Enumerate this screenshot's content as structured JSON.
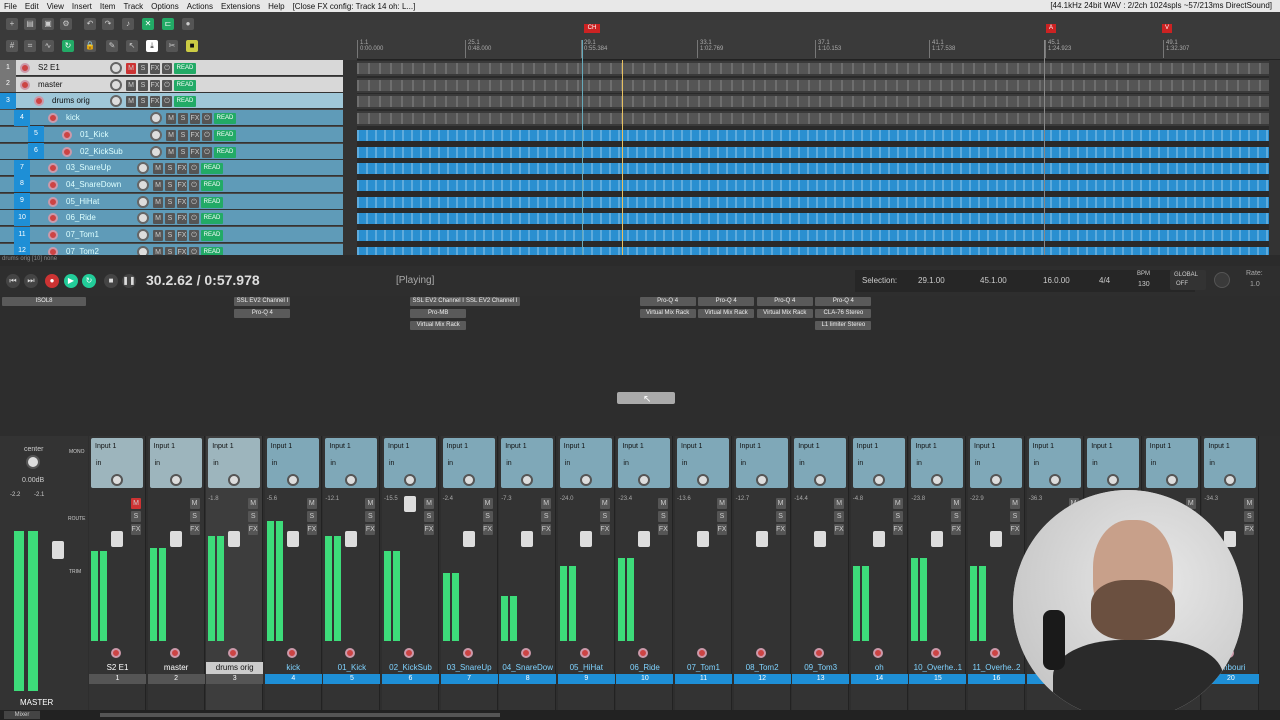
{
  "menu": [
    "File",
    "Edit",
    "View",
    "Insert",
    "Item",
    "Track",
    "Options",
    "Actions",
    "Extensions",
    "Help"
  ],
  "window_title": "[Close FX config: Track 14 oh: L...]",
  "status_right": "[44.1kHz 24bit WAV : 2/2ch 1024spls ~57/213ms DirectSound]",
  "ruler": {
    "markers": [
      "1.1",
      "25.1",
      "29.1",
      "33.1",
      "37.1",
      "41.1",
      "45.1",
      "49.1"
    ],
    "times": [
      "0:00.000",
      "0:48.000",
      "0:55.384",
      "1:02.769",
      "1:10.153",
      "1:17.538",
      "1:24.923",
      "1:32.307"
    ],
    "region_labels": [
      {
        "label": "CH",
        "color": "#cc2222"
      },
      {
        "label": "A",
        "color": "#cc2222"
      },
      {
        "label": "V",
        "color": "#cc2222"
      }
    ]
  },
  "tracks": [
    {
      "num": "1",
      "name": "S2 E1",
      "env": "READ"
    },
    {
      "num": "2",
      "name": "master",
      "env": "READ"
    },
    {
      "num": "3",
      "name": "drums orig",
      "env": "READ"
    },
    {
      "num": "4",
      "name": "kick",
      "env": "READ"
    },
    {
      "num": "5",
      "name": "01_Kick",
      "env": "READ"
    },
    {
      "num": "6",
      "name": "02_KickSub",
      "env": "READ"
    },
    {
      "num": "7",
      "name": "03_SnareUp",
      "env": "READ"
    },
    {
      "num": "8",
      "name": "04_SnareDown",
      "env": "READ"
    },
    {
      "num": "9",
      "name": "05_HiHat",
      "env": "READ"
    },
    {
      "num": "10",
      "name": "06_Ride",
      "env": "READ"
    },
    {
      "num": "11",
      "name": "07_Tom1",
      "env": "READ"
    },
    {
      "num": "12",
      "name": "07_Tom2",
      "env": "READ"
    }
  ],
  "status_line": "drums orig [10] none",
  "transport": {
    "time": "30.2.62 / 0:57.978",
    "state": "[Playing]",
    "selection_label": "Selection:",
    "sel_start": "29.1.00",
    "sel_end": "45.1.00",
    "sel_len": "16.0.00",
    "time_sig": "4/4",
    "bpm_label": "BPM",
    "bpm": "130",
    "global_label": "GLOBAL",
    "global_state": "OFF",
    "rate_label": "Rate:",
    "rate": "1.0"
  },
  "fx": [
    {
      "strip": 0,
      "items": [
        "ISOL8"
      ]
    },
    {
      "strip": 4,
      "items": [
        "SSL EV2 Channel I",
        "Pro-Q 4"
      ]
    },
    {
      "strip": 7,
      "items": [
        "SSL EV2 Channel I",
        "Pro-MB",
        "Virtual Mix Rack"
      ]
    },
    {
      "strip": 8,
      "items": [
        "SSL EV2 Channel I"
      ]
    },
    {
      "strip": 11,
      "items": [
        "Pro-Q 4",
        "Virtual Mix Rack"
      ]
    },
    {
      "strip": 12,
      "items": [
        "Pro-Q 4",
        "Virtual Mix Rack"
      ]
    },
    {
      "strip": 13,
      "items": [
        "Pro-Q 4",
        "Virtual Mix Rack"
      ]
    },
    {
      "strip": 14,
      "items": [
        "Pro-Q 4",
        "CLA-76 Stereo",
        "L1 limiter Stereo"
      ]
    }
  ],
  "master": {
    "label": "MASTER",
    "pan": "center",
    "db": "0.00dB",
    "peak_l": "-2.2",
    "peak_r": "-2.1",
    "mono": "MONO",
    "route": "ROUTE",
    "trim": "TRIM"
  },
  "input_label": "Input 1",
  "in_label": "in",
  "strips": [
    {
      "name": "S2 E1",
      "num": "1"
    },
    {
      "name": "master",
      "num": "2"
    },
    {
      "name": "drums orig",
      "num": "3"
    },
    {
      "name": "kick",
      "num": "4"
    },
    {
      "name": "01_Kick",
      "num": "5"
    },
    {
      "name": "02_KickSub",
      "num": "6"
    },
    {
      "name": "03_SnareUp",
      "num": "7"
    },
    {
      "name": "04_SnareDow",
      "num": "8"
    },
    {
      "name": "05_HiHat",
      "num": "9"
    },
    {
      "name": "06_Ride",
      "num": "10"
    },
    {
      "name": "07_Tom1",
      "num": "11"
    },
    {
      "name": "08_Tom2",
      "num": "12"
    },
    {
      "name": "09_Tom3",
      "num": "13"
    },
    {
      "name": "oh",
      "num": "14"
    },
    {
      "name": "10_Overhe..1",
      "num": "15"
    },
    {
      "name": "11_Overhe..2",
      "num": "16"
    },
    {
      "name": "",
      "num": ""
    },
    {
      "name": "",
      "num": ""
    },
    {
      "name": "",
      "num": ""
    },
    {
      "name": "ambouri",
      "num": "20"
    }
  ],
  "meter_levels": [
    0.6,
    0.62,
    0.7,
    0.8,
    0.7,
    0.6,
    0.45,
    0.3,
    0.5,
    0.55,
    0.0,
    0.0,
    0.0,
    0.5,
    0.55,
    0.5,
    0.0,
    0.0,
    0.0,
    0.4
  ],
  "peak_values": [
    "",
    "",
    "-1.8",
    "-5.6",
    "-12.1",
    "-15.5",
    "-2.4",
    "-7.3",
    "-24.0",
    "-23.4",
    "-13.6",
    "-12.7",
    "-14.4",
    "-4.8",
    "-23.8",
    "-22.9",
    "-36.3",
    "",
    "",
    "-34.3"
  ],
  "mixer_tab": "Mixer",
  "colors": {
    "accent": "#1e8fd6",
    "meter": "#3ddc7a",
    "wave": "#2a8fd0",
    "selected_track": "#9fc7d8"
  }
}
